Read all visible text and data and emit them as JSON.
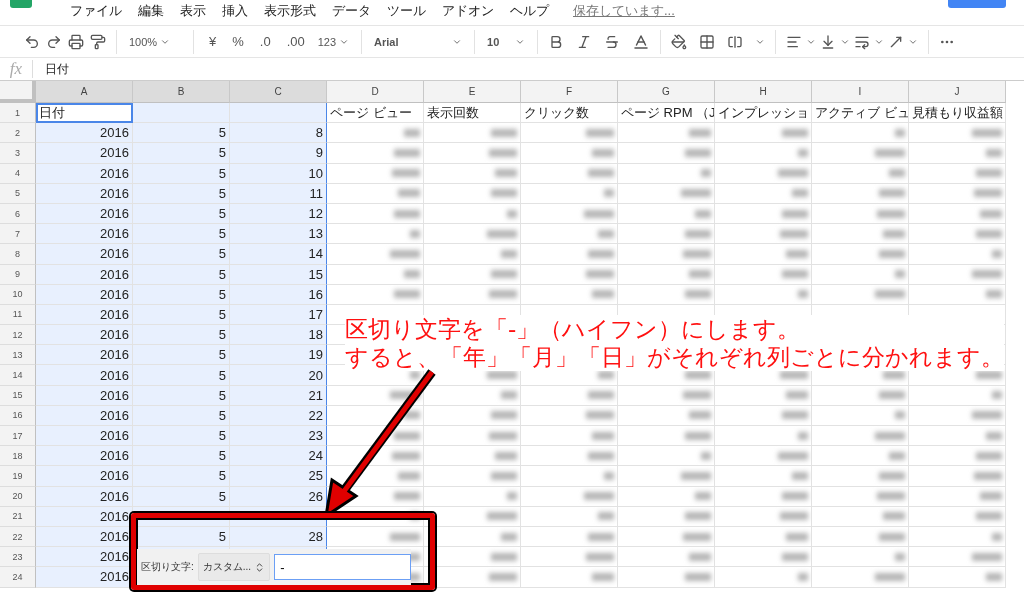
{
  "menu": {
    "items": [
      "ファイル",
      "編集",
      "表示",
      "挿入",
      "表示形式",
      "データ",
      "ツール",
      "アドオン",
      "ヘルプ"
    ],
    "save_status": "保存しています..."
  },
  "toolbar": {
    "zoom": "100%",
    "format_buttons": [
      "¥",
      "%",
      ".0",
      ".00"
    ],
    "number_format": "123",
    "font": "Arial",
    "font_size": "10"
  },
  "formula_bar": {
    "fx": "fx",
    "value": "日付"
  },
  "sheet": {
    "columns": [
      {
        "label": "A",
        "selected": true
      },
      {
        "label": "B",
        "selected": true
      },
      {
        "label": "C",
        "selected": true
      },
      {
        "label": "D",
        "selected": false
      },
      {
        "label": "E",
        "selected": false
      },
      {
        "label": "F",
        "selected": false
      },
      {
        "label": "G",
        "selected": false
      },
      {
        "label": "H",
        "selected": false
      },
      {
        "label": "I",
        "selected": false
      },
      {
        "label": "J",
        "selected": false
      }
    ],
    "rows": [
      {
        "number": "1",
        "kind": "header",
        "cells": [
          "日付",
          "",
          "",
          "ページ ビュー",
          "表示回数",
          "クリック数",
          "ページ RPM （J",
          "インプレッショ",
          "アクティブ ビュ",
          "見積もり収益額"
        ]
      },
      {
        "number": "2",
        "kind": "data",
        "cells": [
          "2016",
          "5",
          "8"
        ]
      },
      {
        "number": "3",
        "kind": "data",
        "cells": [
          "2016",
          "5",
          "9"
        ]
      },
      {
        "number": "4",
        "kind": "data",
        "cells": [
          "2016",
          "5",
          "10"
        ]
      },
      {
        "number": "5",
        "kind": "data",
        "cells": [
          "2016",
          "5",
          "11"
        ]
      },
      {
        "number": "6",
        "kind": "data",
        "cells": [
          "2016",
          "5",
          "12"
        ]
      },
      {
        "number": "7",
        "kind": "data",
        "cells": [
          "2016",
          "5",
          "13"
        ]
      },
      {
        "number": "8",
        "kind": "data",
        "cells": [
          "2016",
          "5",
          "14"
        ]
      },
      {
        "number": "9",
        "kind": "data",
        "cells": [
          "2016",
          "5",
          "15"
        ]
      },
      {
        "number": "10",
        "kind": "data",
        "cells": [
          "2016",
          "5",
          "16"
        ]
      },
      {
        "number": "11",
        "kind": "data",
        "cells": [
          "2016",
          "5",
          "17"
        ]
      },
      {
        "number": "12",
        "kind": "data",
        "cells": [
          "2016",
          "5",
          "18"
        ]
      },
      {
        "number": "13",
        "kind": "data",
        "cells": [
          "2016",
          "5",
          "19"
        ]
      },
      {
        "number": "14",
        "kind": "data",
        "cells": [
          "2016",
          "5",
          "20"
        ]
      },
      {
        "number": "15",
        "kind": "data",
        "cells": [
          "2016",
          "5",
          "21"
        ]
      },
      {
        "number": "16",
        "kind": "data",
        "cells": [
          "2016",
          "5",
          "22"
        ]
      },
      {
        "number": "17",
        "kind": "data",
        "cells": [
          "2016",
          "5",
          "23"
        ]
      },
      {
        "number": "18",
        "kind": "data",
        "cells": [
          "2016",
          "5",
          "24"
        ]
      },
      {
        "number": "19",
        "kind": "data",
        "cells": [
          "2016",
          "5",
          "25"
        ]
      },
      {
        "number": "20",
        "kind": "data",
        "cells": [
          "2016",
          "5",
          "26"
        ]
      },
      {
        "number": "21",
        "kind": "data",
        "cells": [
          "2016"
        ]
      },
      {
        "number": "22",
        "kind": "data",
        "cells": [
          "2016",
          "5",
          "28"
        ]
      },
      {
        "number": "23",
        "kind": "data",
        "cells": [
          "2016"
        ]
      },
      {
        "number": "24",
        "kind": "data",
        "cells": [
          "2016"
        ]
      }
    ]
  },
  "separator_panel": {
    "label": "区切り文字:",
    "select": "カスタム...",
    "value": "-"
  },
  "annotation": {
    "lines": [
      "区切り文字を「-」（ハイフン）にします。",
      "すると、「年」「月」「日」がそれぞれ列ごとに分かれます。"
    ]
  }
}
